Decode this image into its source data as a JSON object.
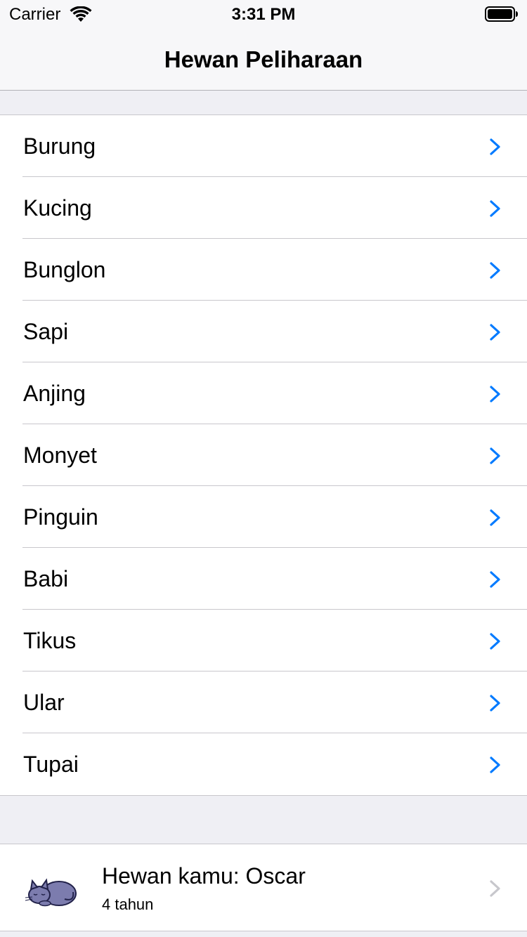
{
  "status_bar": {
    "carrier": "Carrier",
    "time": "3:31 PM",
    "wifi_icon": "wifi-icon",
    "battery_icon": "battery-icon"
  },
  "nav": {
    "title": "Hewan Peliharaan"
  },
  "animals": [
    {
      "label": "Burung"
    },
    {
      "label": "Kucing"
    },
    {
      "label": "Bunglon"
    },
    {
      "label": "Sapi"
    },
    {
      "label": "Anjing"
    },
    {
      "label": "Monyet"
    },
    {
      "label": "Pinguin"
    },
    {
      "label": "Babi"
    },
    {
      "label": "Tikus"
    },
    {
      "label": "Ular"
    },
    {
      "label": "Tupai"
    }
  ],
  "your_pet": {
    "title": "Hewan kamu: Oscar",
    "subtitle": "4 tahun",
    "icon": "cat-icon"
  },
  "colors": {
    "accent": "#007aff",
    "chevron_disabled": "#c7c7cc",
    "background": "#efeff4",
    "separator": "#c8c7cc"
  }
}
